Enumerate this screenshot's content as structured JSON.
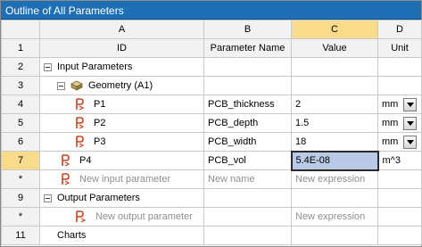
{
  "title": "Outline of All Parameters",
  "columns": {
    "letters": [
      "A",
      "B",
      "C",
      "D"
    ],
    "headers": [
      "ID",
      "Parameter Name",
      "Value",
      "Unit"
    ]
  },
  "rows": {
    "r1": "1",
    "r2": {
      "num": "2",
      "label": "Input Parameters"
    },
    "r3": {
      "num": "3",
      "label": "Geometry (A1)"
    },
    "r4": {
      "num": "4",
      "id": "P1",
      "name": "PCB_thickness",
      "value": "2",
      "unit": "mm"
    },
    "r5": {
      "num": "5",
      "id": "P2",
      "name": "PCB_depth",
      "value": "1.5",
      "unit": "mm"
    },
    "r6": {
      "num": "6",
      "id": "P3",
      "name": "PCB_width",
      "value": "18",
      "unit": "mm"
    },
    "r7": {
      "num": "7",
      "id": "P4",
      "name": "PCB_vol",
      "value": "5.4E-08",
      "unit": "m^3"
    },
    "r8": {
      "num": "*",
      "id": "New input parameter",
      "name": "New name",
      "value": "New expression"
    },
    "r9": {
      "num": "9",
      "label": "Output Parameters"
    },
    "r10": {
      "num": "*",
      "id": "New output parameter",
      "value": "New expression"
    },
    "r11": {
      "num": "11",
      "label": "Charts"
    }
  },
  "colors": {
    "title_bar": "#1f6fb6",
    "selection": "#f8dc8c",
    "selected_cell": "#b9c9e6",
    "param_icon": "#d0401a"
  },
  "icons": [
    "expander-minus-icon",
    "geometry-icon",
    "parameter-icon",
    "output-parameter-icon",
    "chevron-down-icon"
  ]
}
